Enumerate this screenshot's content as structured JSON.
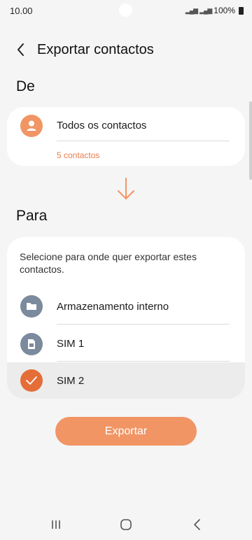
{
  "status": {
    "time": "10.00",
    "battery": "100%"
  },
  "header": {
    "title": "Exportar contactos"
  },
  "from_section": {
    "label": "De",
    "option": {
      "label": "Todos os contactos",
      "count": "5 contactos"
    }
  },
  "to_section": {
    "label": "Para",
    "instruction": "Selecione para onde quer exportar estes contactos.",
    "options": [
      {
        "label": "Armazenamento interno",
        "icon": "folder-icon",
        "selected": false
      },
      {
        "label": "SIM 1",
        "icon": "sim-card-icon",
        "selected": false
      },
      {
        "label": "SIM 2",
        "icon": "checkmark-icon",
        "selected": true
      }
    ]
  },
  "export_button": {
    "label": "Exportar"
  },
  "colors": {
    "accent": "#f19565",
    "icon_grey": "#7b8a9c",
    "selected_bg": "#ececec"
  }
}
